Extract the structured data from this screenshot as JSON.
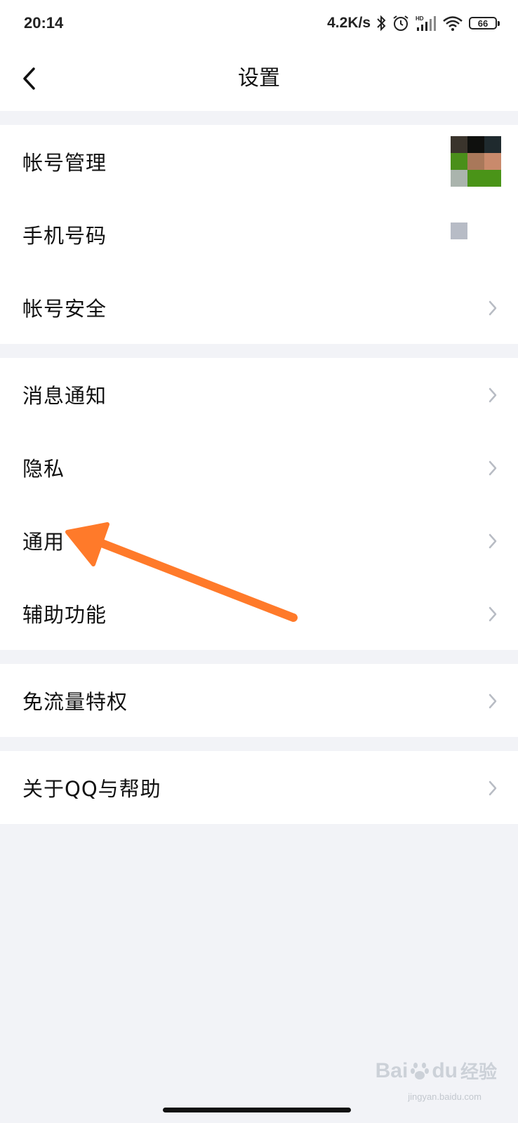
{
  "status_bar": {
    "time": "20:14",
    "net_speed": "4.2K/s",
    "battery_level": "66",
    "icons": [
      "bluetooth-icon",
      "alarm-icon",
      "hd-signal-icon",
      "wifi-icon",
      "battery-icon"
    ]
  },
  "header": {
    "title": "设置",
    "back_icon": "chevron-left-icon"
  },
  "groups": [
    {
      "items": [
        {
          "label": "帐号管理",
          "trailing": "avatar"
        },
        {
          "label": "手机号码",
          "trailing": "masked-value"
        },
        {
          "label": "帐号安全",
          "trailing": "chevron-right-icon"
        }
      ]
    },
    {
      "items": [
        {
          "label": "消息通知",
          "trailing": "chevron-right-icon"
        },
        {
          "label": "隐私",
          "trailing": "chevron-right-icon"
        },
        {
          "label": "通用",
          "trailing": "chevron-right-icon"
        },
        {
          "label": "辅助功能",
          "trailing": "chevron-right-icon"
        }
      ]
    },
    {
      "items": [
        {
          "label": "免流量特权",
          "trailing": "chevron-right-icon"
        }
      ]
    },
    {
      "items": [
        {
          "label": "关于QQ与帮助",
          "trailing": "chevron-right-icon"
        }
      ]
    }
  ],
  "annotation": {
    "icon": "orange-arrow-icon",
    "color": "#ff7a2a",
    "points_to": "通用"
  },
  "avatar_colors": [
    "#3a342c",
    "#0f100e",
    "#1f2a2e",
    "#4a8f1a",
    "#a9785a",
    "#c98a6c",
    "#aab4ad",
    "#4a9418",
    "#4a9418"
  ],
  "colors": {
    "page_background": "#f2f3f7",
    "card_background": "#ffffff",
    "text_primary": "#111111",
    "chevron": "#b8bcc4"
  },
  "watermark": {
    "brand": "Bai",
    "brand2": "du",
    "cn": "经验",
    "url": "jingyan.baidu.com"
  }
}
